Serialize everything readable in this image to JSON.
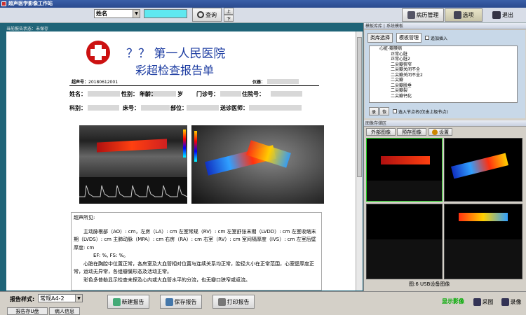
{
  "app": {
    "title": "超声医学影像工作站"
  },
  "toolbar": {
    "field_select": "姓名",
    "search_value": "",
    "query_label": "查询",
    "up_label": "上",
    "down_label": "下",
    "history_label": "病历管理",
    "options_label": "选项",
    "exit_label": "退出"
  },
  "report": {
    "status": "当前报告状态：未保存",
    "hospital": "？？ 第一人民医院",
    "title": "彩超检查报告单",
    "report_no_label": "超声号：",
    "report_no": "20180612001",
    "device_label": "仪器：",
    "labels": {
      "name": "姓名：",
      "sex": "性别：",
      "age": "年龄：",
      "age_unit": "岁",
      "clinic": "门诊号：",
      "inpatient": "住院号：",
      "dept": "科别：",
      "bed": "床号：",
      "part": "部位：",
      "doctor": "送诊医师："
    },
    "findings_title": "超声所见:",
    "findings": [
      "主动脉根部（AO）: cm，左房（LA）: cm 左室常规（RV）: cm 左室舒张末期（LVDD）: cm 左室收缩末期（LVDS）: cm 主肺动脉（MPA）: cm 右房（RA）: cm 右室（RV）: cm 室间隔厚度（IVS）: cm  左室后壁厚度: cm",
      "EF: %, FS: %。",
      "心脏在胸腔中位置正常，各房室及大血管相对位置与连续关系均正常，腔径大小在正常范围，心室壁厚度正常，运动无异常，各组瓣膜形态及活动正常。",
      "彩色多普勒显示检查未探及心内或大血管水平的分流，也无瓣口狭窄或返流。"
    ]
  },
  "right": {
    "template_lib": "模板库库 | 系统模板",
    "tab_lib": "类库选择",
    "tab_tpl": "模板管理",
    "append_label": "追加插入",
    "tree": [
      "心脏-瓣膜病",
      "正常心脏",
      "正常心脏2",
      "二尖瓣狭窄",
      "二尖瓣关闭不全",
      "二尖瓣关闭不全2",
      "二尖瓣",
      "二尖瓣脱垂",
      "二尖瓣裂",
      "二尖瓣钙化"
    ],
    "load_label": "录",
    "reset_label": "恢",
    "select_parent_label": "选入节点名(仅由上级节点)",
    "image_area": "图像存储区",
    "ext_image": "外部图像",
    "save_image": "预存图像",
    "settings_label": "设置",
    "image_caption": "图:6   USB设备图像"
  },
  "bottom": {
    "style_label": "报告样式:",
    "style_value": "常规A4-2",
    "new_report": "新建报告",
    "save_report": "保存报告",
    "print_report": "打印报告",
    "show_image": "显示影像",
    "capture": "采图",
    "record": "录像",
    "tab1": "报告存U盘",
    "tab2": "病人信息"
  },
  "colors": {
    "accent": "#1f6478",
    "logo": "#cc1111"
  }
}
